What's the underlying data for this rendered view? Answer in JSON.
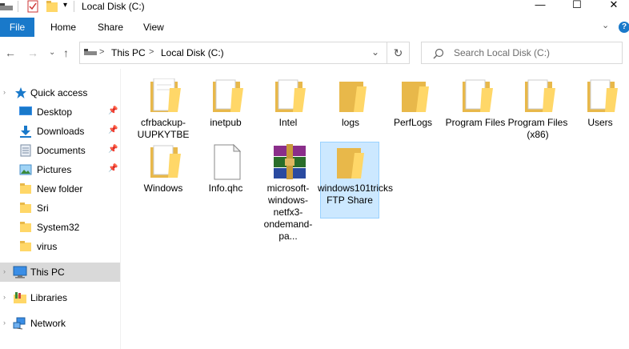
{
  "window": {
    "title": "Local Disk (C:)",
    "minimize_glyph": "—",
    "maximize_glyph": "☐",
    "close_glyph": "✕"
  },
  "ribbon": {
    "tabs": [
      "File",
      "Home",
      "Share",
      "View"
    ],
    "help_glyph": "?"
  },
  "address": {
    "crumbs": [
      "This PC",
      "Local Disk (C:)"
    ],
    "separator": ">"
  },
  "search": {
    "placeholder": "Search Local Disk (C:)"
  },
  "sidebar": {
    "quick_access": "Quick access",
    "items": [
      {
        "label": "Desktop",
        "icon": "desktop-icon",
        "pinned": true
      },
      {
        "label": "Downloads",
        "icon": "downloads-icon",
        "pinned": true
      },
      {
        "label": "Documents",
        "icon": "documents-icon",
        "pinned": true
      },
      {
        "label": "Pictures",
        "icon": "pictures-icon",
        "pinned": true
      },
      {
        "label": "New folder",
        "icon": "folder-icon",
        "pinned": false
      },
      {
        "label": "Sri",
        "icon": "folder-icon",
        "pinned": false
      },
      {
        "label": "System32",
        "icon": "folder-icon",
        "pinned": false
      },
      {
        "label": "virus",
        "icon": "folder-icon",
        "pinned": false
      }
    ],
    "this_pc": "This PC",
    "libraries": "Libraries",
    "network": "Network"
  },
  "files": [
    {
      "name": "cfrbackup-UUPKYTBE",
      "type": "folder-doc"
    },
    {
      "name": "inetpub",
      "type": "folder-doc"
    },
    {
      "name": "Intel",
      "type": "folder-doc"
    },
    {
      "name": "logs",
      "type": "folder"
    },
    {
      "name": "PerfLogs",
      "type": "folder"
    },
    {
      "name": "Program Files",
      "type": "folder-doc"
    },
    {
      "name": "Program Files (x86)",
      "type": "folder-doc"
    },
    {
      "name": "Users",
      "type": "folder-doc"
    },
    {
      "name": "Windows",
      "type": "folder-doc"
    },
    {
      "name": "Info.qhc",
      "type": "file"
    },
    {
      "name": "microsoft-windows-netfx3-ondemand-pa...",
      "type": "archive"
    },
    {
      "name": "windows101tricks FTP Share",
      "type": "folder",
      "selected": true
    }
  ],
  "colors": {
    "accent": "#1979ca",
    "folder": "#ffd768",
    "selection": "#cce8ff",
    "sidebar_selected": "#d9d9d9"
  }
}
